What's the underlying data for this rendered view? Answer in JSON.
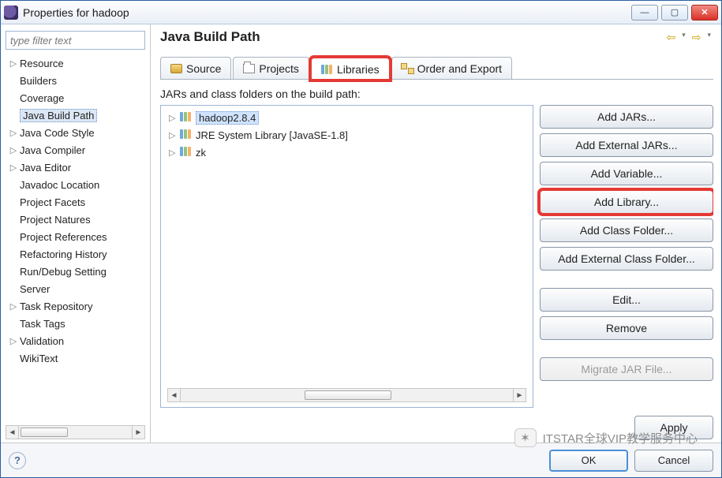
{
  "window": {
    "title": "Properties for hadoop"
  },
  "filter_placeholder": "type filter text",
  "left_tree": [
    {
      "label": "Resource",
      "expandable": true
    },
    {
      "label": "Builders",
      "expandable": false
    },
    {
      "label": "Coverage",
      "expandable": false
    },
    {
      "label": "Java Build Path",
      "expandable": false,
      "selected": true
    },
    {
      "label": "Java Code Style",
      "expandable": true
    },
    {
      "label": "Java Compiler",
      "expandable": true
    },
    {
      "label": "Java Editor",
      "expandable": true
    },
    {
      "label": "Javadoc Location",
      "expandable": false
    },
    {
      "label": "Project Facets",
      "expandable": false
    },
    {
      "label": "Project Natures",
      "expandable": false
    },
    {
      "label": "Project References",
      "expandable": false
    },
    {
      "label": "Refactoring History",
      "expandable": false
    },
    {
      "label": "Run/Debug Setting",
      "expandable": false
    },
    {
      "label": "Server",
      "expandable": false
    },
    {
      "label": "Task Repository",
      "expandable": true
    },
    {
      "label": "Task Tags",
      "expandable": false
    },
    {
      "label": "Validation",
      "expandable": true
    },
    {
      "label": "WikiText",
      "expandable": false
    }
  ],
  "page": {
    "title": "Java Build Path"
  },
  "tabs": [
    {
      "key": "source",
      "label": "Source"
    },
    {
      "key": "projects",
      "label": "Projects"
    },
    {
      "key": "libraries",
      "label": "Libraries",
      "active": true,
      "highlight": true
    },
    {
      "key": "order",
      "label": "Order and Export"
    }
  ],
  "libs": {
    "subhead": "JARs and class folders on the build path:",
    "items": [
      {
        "label": "hadoop2.8.4",
        "selected": true
      },
      {
        "label": "JRE System Library [JavaSE-1.8]"
      },
      {
        "label": "zk"
      }
    ]
  },
  "buttons": {
    "add_jars": "Add JARs...",
    "add_ext_jars": "Add External JARs...",
    "add_variable": "Add Variable...",
    "add_library": "Add Library...",
    "add_class_folder": "Add Class Folder...",
    "add_ext_class_folder": "Add External Class Folder...",
    "edit": "Edit...",
    "remove": "Remove",
    "migrate": "Migrate JAR File...",
    "apply": "Apply",
    "ok": "OK",
    "cancel": "Cancel"
  },
  "watermark": "ITSTAR全球VIP教学服务中心"
}
